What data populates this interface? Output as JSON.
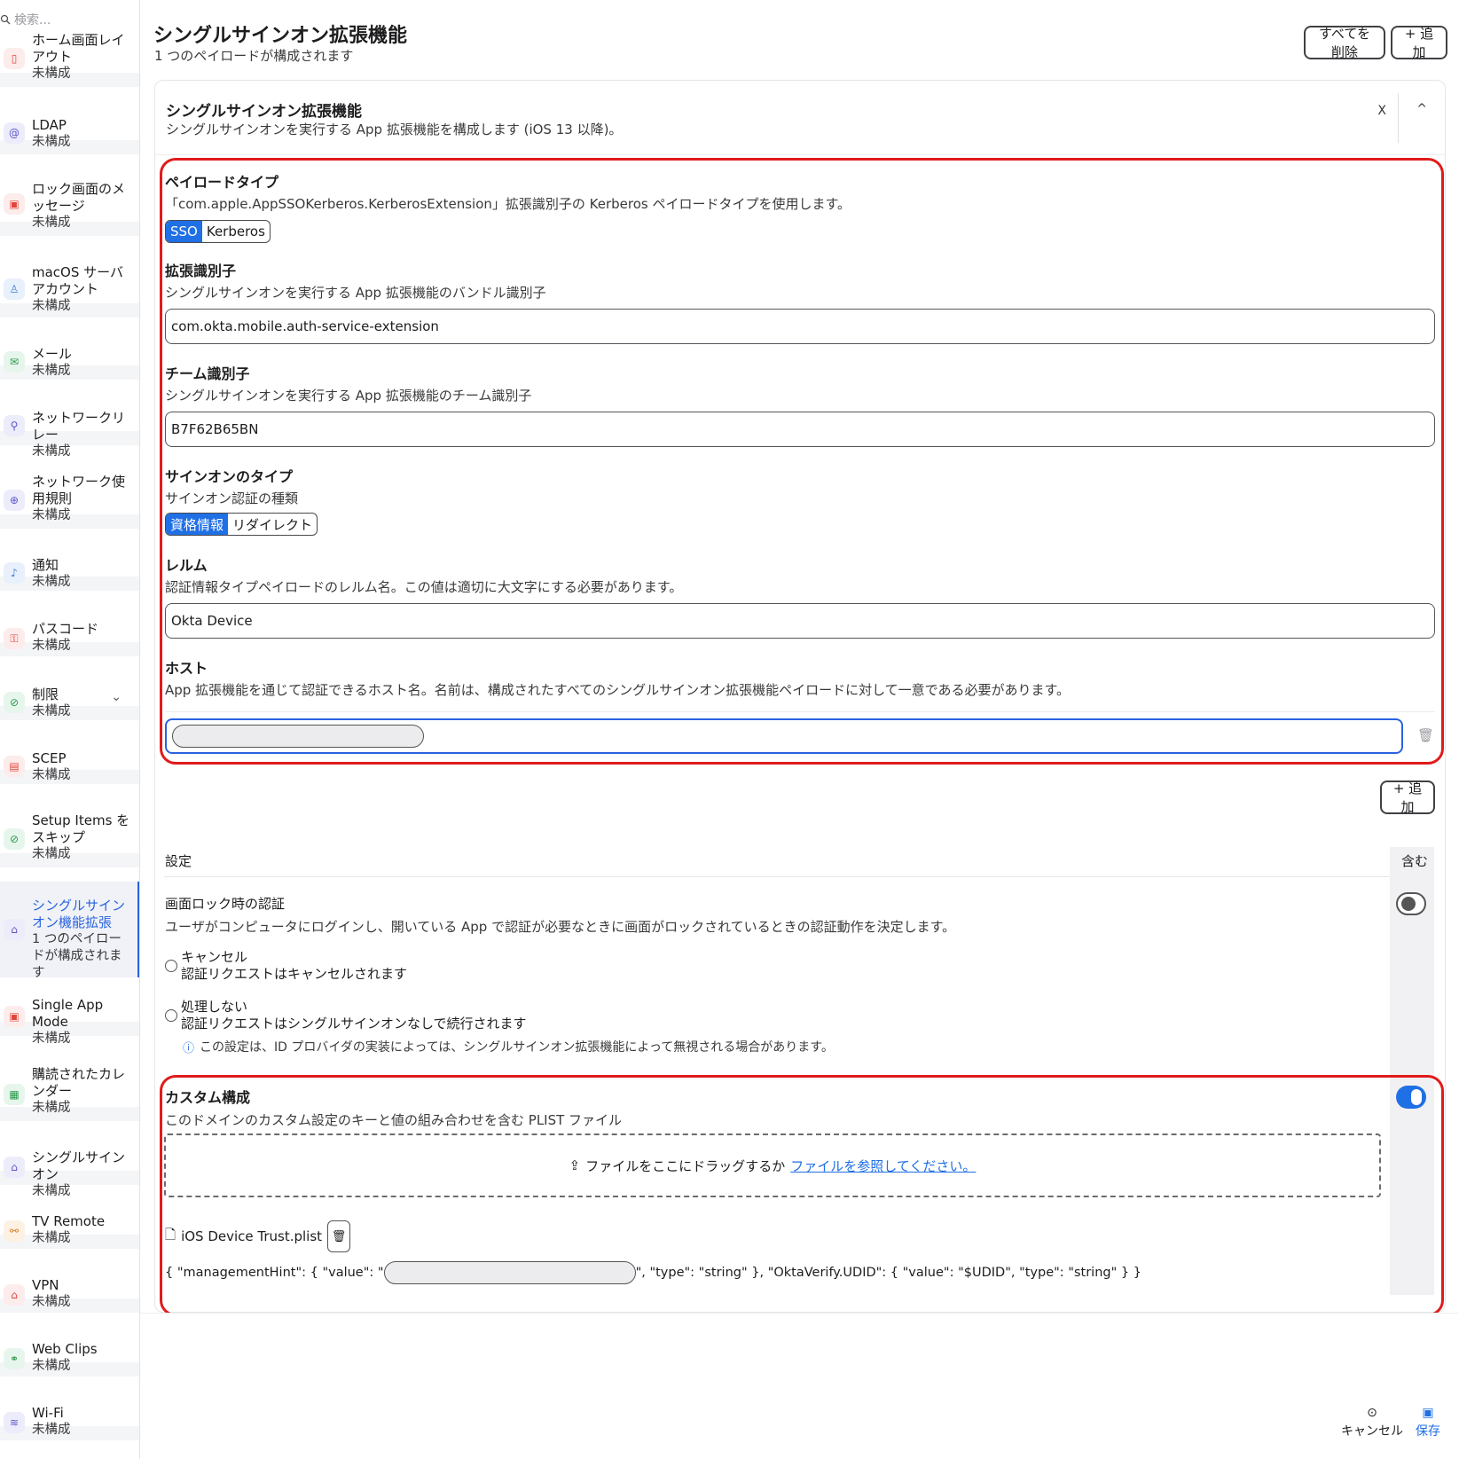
{
  "sidebar": {
    "search_placeholder": "検索...",
    "items": [
      {
        "title": "ホーム画面レイアウト",
        "sub": "未構成"
      },
      {
        "title": "LDAP",
        "sub": "未構成"
      },
      {
        "title": "ロック画面のメッセージ",
        "sub": "未構成"
      },
      {
        "title": "macOS サーバアカウント",
        "sub": "未構成"
      },
      {
        "title": "メール",
        "sub": "未構成"
      },
      {
        "title": "ネットワークリレー",
        "sub": "未構成"
      },
      {
        "title": "ネットワーク使用規則",
        "sub": "未構成"
      },
      {
        "title": "通知",
        "sub": "未構成"
      },
      {
        "title": "パスコード",
        "sub": "未構成"
      },
      {
        "title": "制限",
        "sub": "未構成"
      },
      {
        "title": "SCEP",
        "sub": "未構成"
      },
      {
        "title": "Setup Items をスキップ",
        "sub": "未構成"
      },
      {
        "title": "シングルサインオン機能拡張",
        "sub": "1 つのペイロードが構成されます"
      },
      {
        "title": "Single App Mode",
        "sub": "未構成"
      },
      {
        "title": "購読されたカレンダー",
        "sub": "未構成"
      },
      {
        "title": "シングルサインオン",
        "sub": "未構成"
      },
      {
        "title": "TV Remote",
        "sub": "未構成"
      },
      {
        "title": "VPN",
        "sub": "未構成"
      },
      {
        "title": "Web Clips",
        "sub": "未構成"
      },
      {
        "title": "Wi-Fi",
        "sub": "未構成"
      }
    ]
  },
  "header": {
    "title": "シングルサインオン拡張機能",
    "subtitle": "1 つのペイロードが構成されます",
    "delete_all": "すべてを削除",
    "add": "+ 追加"
  },
  "card": {
    "title": "シングルサインオン拡張機能",
    "desc": "シングルサインオンを実行する App 拡張機能を構成します (iOS 13 以降)。",
    "close": "X",
    "collapse": "^"
  },
  "payload": {
    "label": "ペイロードタイプ",
    "desc": "「com.apple.AppSSOKerberos.KerberosExtension」拡張識別子の Kerberos ペイロードタイプを使用します。",
    "opt_sso": "SSO",
    "opt_kerberos": "Kerberos"
  },
  "ext_id": {
    "label": "拡張識別子",
    "desc": "シングルサインオンを実行する App 拡張機能のバンドル識別子",
    "value": "com.okta.mobile.auth-service-extension"
  },
  "team_id": {
    "label": "チーム識別子",
    "desc": "シングルサインオンを実行する App 拡張機能のチーム識別子",
    "value": "B7F62B65BN"
  },
  "signon": {
    "label": "サインオンのタイプ",
    "desc": "サインオン認証の種類",
    "opt_cred": "資格情報",
    "opt_redirect": "リダイレクト"
  },
  "realm": {
    "label": "レルム",
    "desc": "認証情報タイプペイロードのレルム名。この値は適切に大文字にする必要があります。",
    "value": "Okta Device"
  },
  "hosts": {
    "label": "ホスト",
    "desc": "App 拡張機能を通じて認証できるホスト名。名前は、構成されたすべてのシングルサインオン拡張機能ペイロードに対して一意である必要があります。",
    "add": "+ 追加"
  },
  "settings": {
    "header": "設定",
    "include": "含む",
    "lock_title": "画面ロック時の認証",
    "lock_desc": "ユーザがコンピュータにログインし、開いている App で認証が必要なときに画面がロックされているときの認証動作を決定します。",
    "opt_cancel": "キャンセル",
    "opt_cancel_desc": "認証リクエストはキャンセルされます",
    "opt_none": "処理しない",
    "opt_none_desc": "認証リクエストはシングルサインオンなしで続行されます",
    "note": "この設定は、ID プロバイダの実装によっては、シングルサインオン拡張機能によって無視される場合があります。",
    "custom_title": "カスタム構成",
    "custom_desc": "このドメインのカスタム設定のキーと値の組み合わせを含む PLIST ファイル",
    "drop_text": "ファイルをここにドラッグするか",
    "drop_link": "ファイルを参照してください。",
    "file_name": "iOS Device Trust.plist",
    "plist_prefix": "{ \"managementHint\": { \"value\": \"",
    "plist_suffix": "\", \"type\": \"string\" }, \"OktaVerify.UDID\": { \"value\": \"$UDID\", \"type\": \"string\" } }"
  },
  "footer": {
    "cancel": "キャンセル",
    "save": "保存"
  },
  "colors": {
    "accent": "#1f6fe5",
    "highlight": "#e01b1b"
  }
}
